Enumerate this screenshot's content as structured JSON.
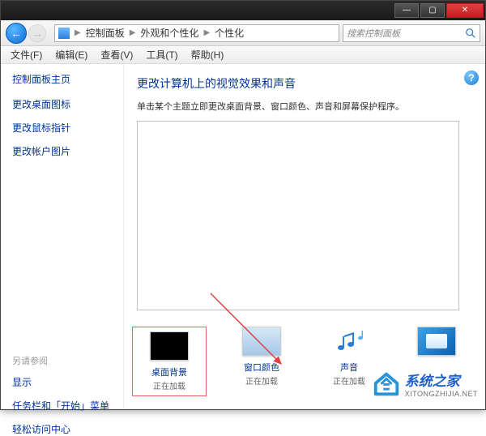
{
  "titlebar": {
    "min": "—",
    "max": "▢",
    "close": "✕"
  },
  "nav": {
    "crumbs": [
      "控制面板",
      "外观和个性化",
      "个性化"
    ],
    "search_placeholder": "搜索控制面板"
  },
  "menu": {
    "file": "文件(F)",
    "edit": "编辑(E)",
    "view": "查看(V)",
    "tools": "工具(T)",
    "help": "帮助(H)"
  },
  "sidebar": {
    "home": "控制面板主页",
    "links": [
      "更改桌面图标",
      "更改鼠标指针",
      "更改帐户图片"
    ],
    "see_also": "另请参阅",
    "secondary": [
      "显示",
      "任务栏和「开始」菜单",
      "轻松访问中心"
    ]
  },
  "main": {
    "title": "更改计算机上的视觉效果和声音",
    "subtitle": "单击某个主题立即更改桌面背景、窗口颜色、声音和屏幕保护程序。",
    "help": "?"
  },
  "bottom": {
    "items": [
      {
        "label": "桌面背景",
        "status": "正在加载"
      },
      {
        "label": "窗口颜色",
        "status": "正在加载"
      },
      {
        "label": "声音",
        "status": "正在加载"
      },
      {
        "label": "",
        "status": ""
      }
    ]
  },
  "watermark": {
    "brand": "系统之家",
    "url": "XITONGZHIJIA.NET"
  }
}
